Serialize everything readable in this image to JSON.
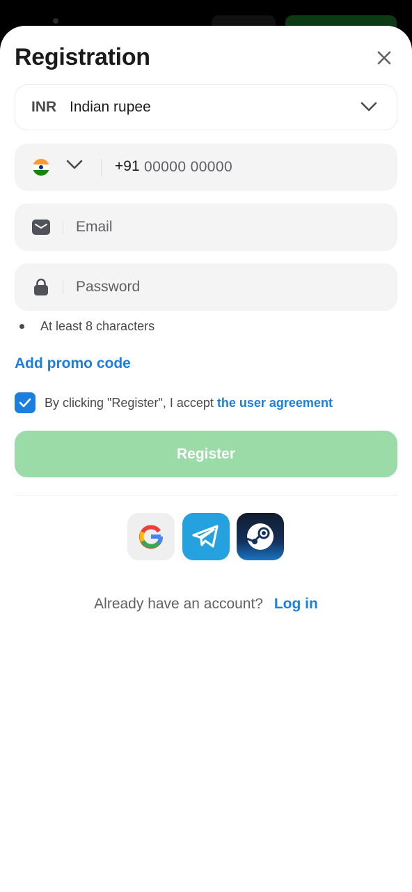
{
  "modal": {
    "title": "Registration"
  },
  "currency": {
    "code": "INR",
    "name": "Indian rupee"
  },
  "phone": {
    "country": "India",
    "prefix": "+91",
    "placeholder": "00000 00000"
  },
  "email": {
    "placeholder": "Email"
  },
  "password": {
    "placeholder": "Password",
    "hint": "At least 8 characters"
  },
  "promo": {
    "label": "Add promo code"
  },
  "agreement": {
    "checked": true,
    "text": "By clicking \"Register\", I accept",
    "link": "the user agreement"
  },
  "register": {
    "label": "Register"
  },
  "social": [
    {
      "name": "google-icon"
    },
    {
      "name": "telegram-icon"
    },
    {
      "name": "steam-icon"
    }
  ],
  "login": {
    "text": "Already have an account?",
    "link": "Log in"
  },
  "colors": {
    "accent": "#1a7fe0",
    "register_disabled": "#9bdba8",
    "field_bg": "#f4f4f5"
  }
}
